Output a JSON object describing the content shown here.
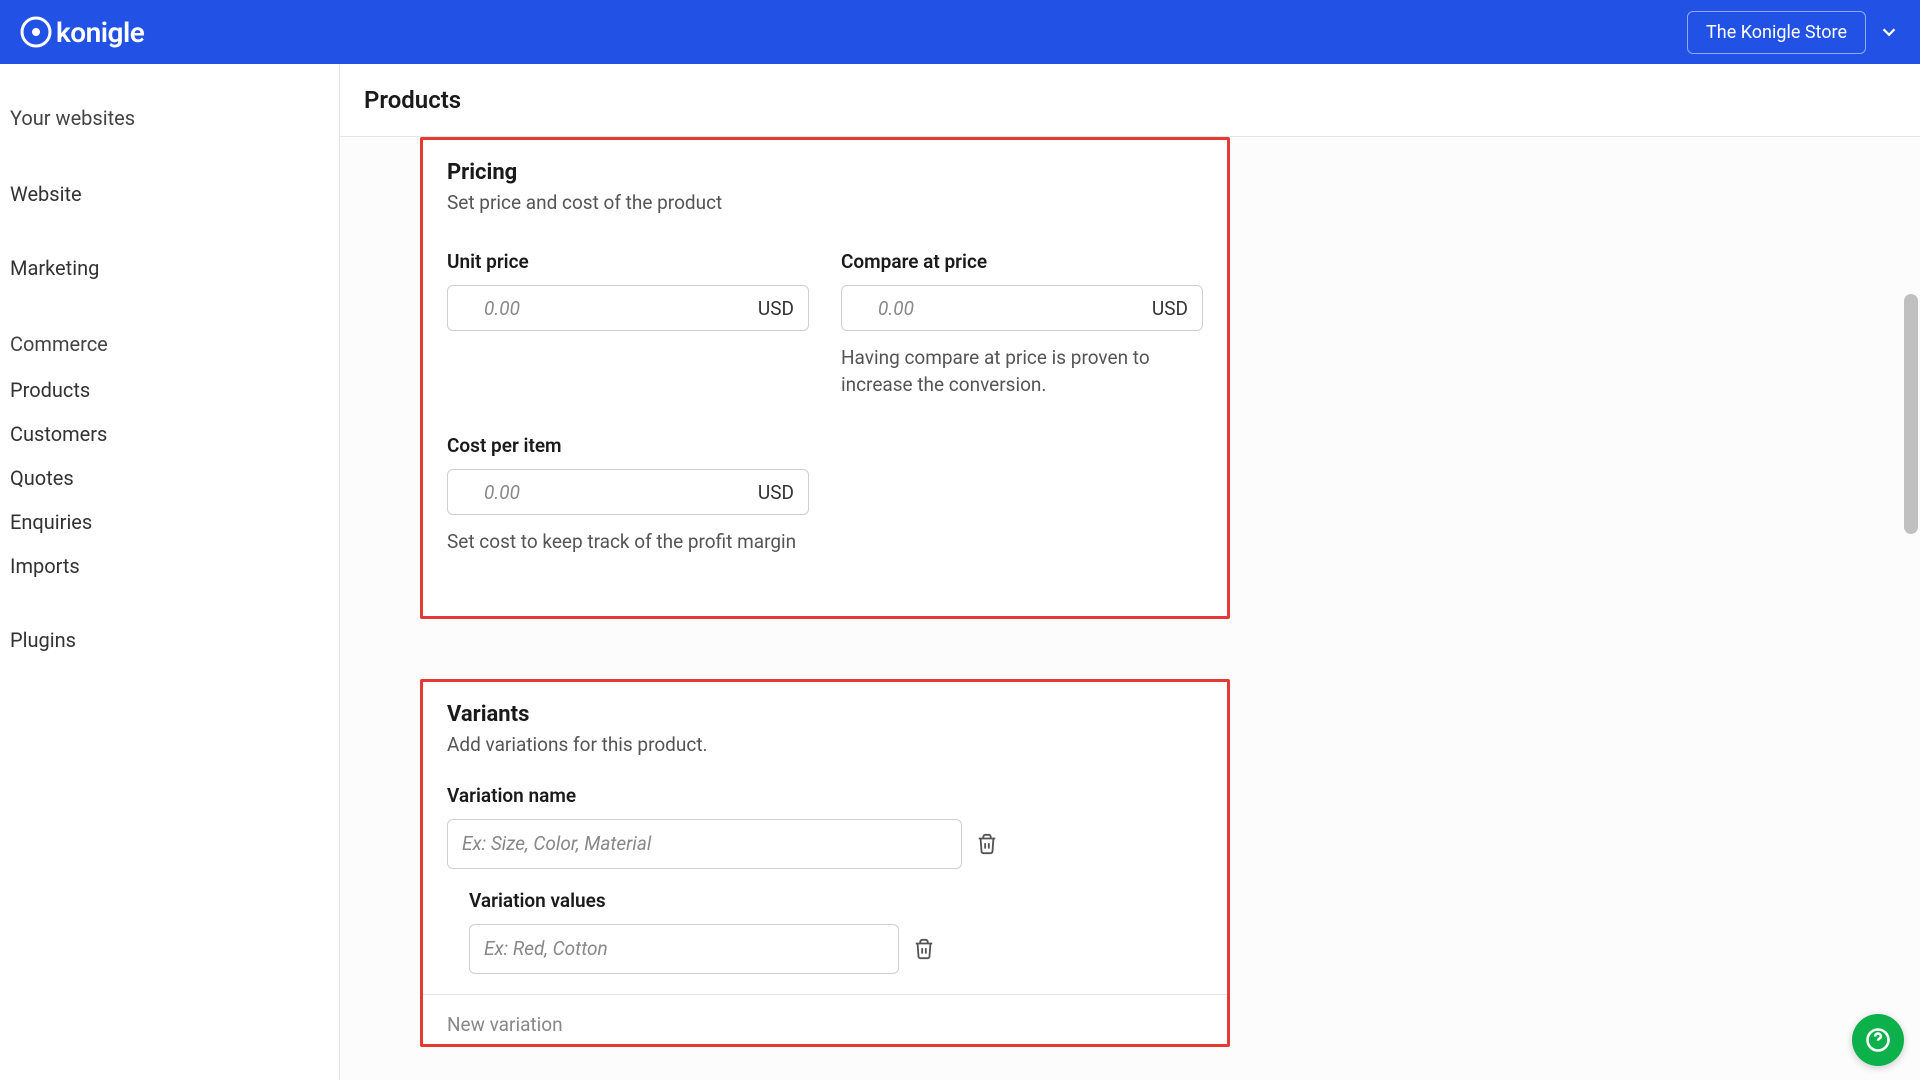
{
  "header": {
    "logo_text": "konigle",
    "store_name": "The Konigle Store"
  },
  "sidebar": {
    "heading_websites": "Your websites",
    "items_top": [
      "Website",
      "Marketing"
    ],
    "heading_commerce": "Commerce",
    "items_commerce": [
      "Products",
      "Customers",
      "Quotes",
      "Enquiries",
      "Imports"
    ],
    "item_plugins": "Plugins"
  },
  "page": {
    "title": "Products"
  },
  "pricing": {
    "title": "Pricing",
    "subtitle": "Set price and cost of the product",
    "unit_price_label": "Unit price",
    "unit_price_placeholder": "0.00",
    "currency": "USD",
    "compare_label": "Compare at price",
    "compare_placeholder": "0.00",
    "compare_help": "Having compare at price is proven to increase the conversion.",
    "cost_label": "Cost per item",
    "cost_placeholder": "0.00",
    "cost_help": "Set cost to keep track of the profit margin"
  },
  "variants": {
    "title": "Variants",
    "subtitle": "Add variations for this product.",
    "name_label": "Variation name",
    "name_placeholder": "Ex: Size, Color, Material",
    "values_label": "Variation values",
    "values_placeholder": "Ex: Red, Cotton",
    "new_variation": "New variation"
  }
}
